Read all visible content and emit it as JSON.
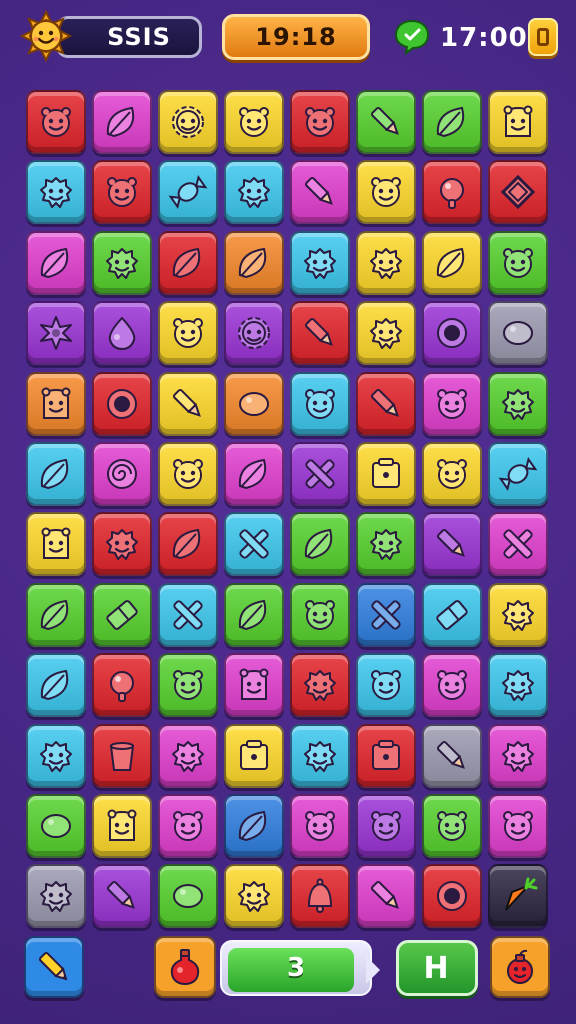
{
  "hud": {
    "score": "SSIS",
    "timer": "19:18",
    "coins": "17:00",
    "avatar_icon": "sun-face-icon",
    "coin_icon": "green-chat-icon",
    "pause_icon": "pause-icon"
  },
  "colors": {
    "R": "#e3242b",
    "O": "#f5882a",
    "Y": "#ffd92a",
    "G": "#56d22d",
    "C": "#3cc8ee",
    "B": "#2f7fe0",
    "P": "#9a33d6",
    "M": "#e23fd0",
    "K": "#9c9ab0",
    "D": "#2b2540"
  },
  "board": {
    "rows": [
      [
        "R:face",
        "M:leaf",
        "Y:gear",
        "Y:face",
        "R:face",
        "G:pen",
        "G:leaf",
        "Y:ghost"
      ],
      [
        "C:blob",
        "R:face",
        "C:candy",
        "C:blob",
        "M:pen",
        "Y:face",
        "R:ball",
        "R:diamond"
      ],
      [
        "M:leaf",
        "G:blob",
        "R:leaf",
        "O:leaf",
        "C:blob",
        "Y:blob",
        "Y:leaf",
        "G:face"
      ],
      [
        "P:star",
        "P:drop",
        "Y:face",
        "P:gear",
        "R:pen",
        "Y:blob",
        "P:ring",
        "K:lemon"
      ],
      [
        "O:ghost",
        "R:ring",
        "Y:pen",
        "O:lemon",
        "C:face",
        "R:pen",
        "M:face",
        "G:blob"
      ],
      [
        "C:leaf",
        "M:swirl",
        "Y:face",
        "M:leaf",
        "P:cross",
        "Y:box",
        "Y:face",
        "C:candy"
      ],
      [
        "Y:ghost",
        "R:blob",
        "R:leaf",
        "C:cross",
        "G:leaf",
        "G:blob",
        "P:pen",
        "M:cross"
      ],
      [
        "G:leaf",
        "G:eraser",
        "C:cross",
        "G:leaf",
        "G:face",
        "B:cross",
        "C:eraser",
        "Y:blob"
      ],
      [
        "C:leaf",
        "R:ball",
        "G:face",
        "M:ghost",
        "R:blob",
        "C:face",
        "M:face",
        "C:blob"
      ],
      [
        "C:blob",
        "R:cup",
        "M:blob",
        "Y:box",
        "C:blob",
        "R:box",
        "K:pen",
        "M:blob"
      ],
      [
        "G:lemon",
        "Y:ghost",
        "M:face",
        "B:leaf",
        "M:face",
        "P:face",
        "G:face",
        "M:face"
      ],
      [
        "K:blob",
        "P:pen",
        "G:lemon",
        "Y:blob",
        "R:bell",
        "M:pen",
        "R:ring",
        "D:carrot"
      ]
    ]
  },
  "bottom": {
    "moves_label": "3",
    "moves_progress": 0.9,
    "plus_label": "H",
    "left_button_icon": "pencil-icon",
    "potion_icon": "potion-icon",
    "bomb_icon": "bomb-icon"
  }
}
